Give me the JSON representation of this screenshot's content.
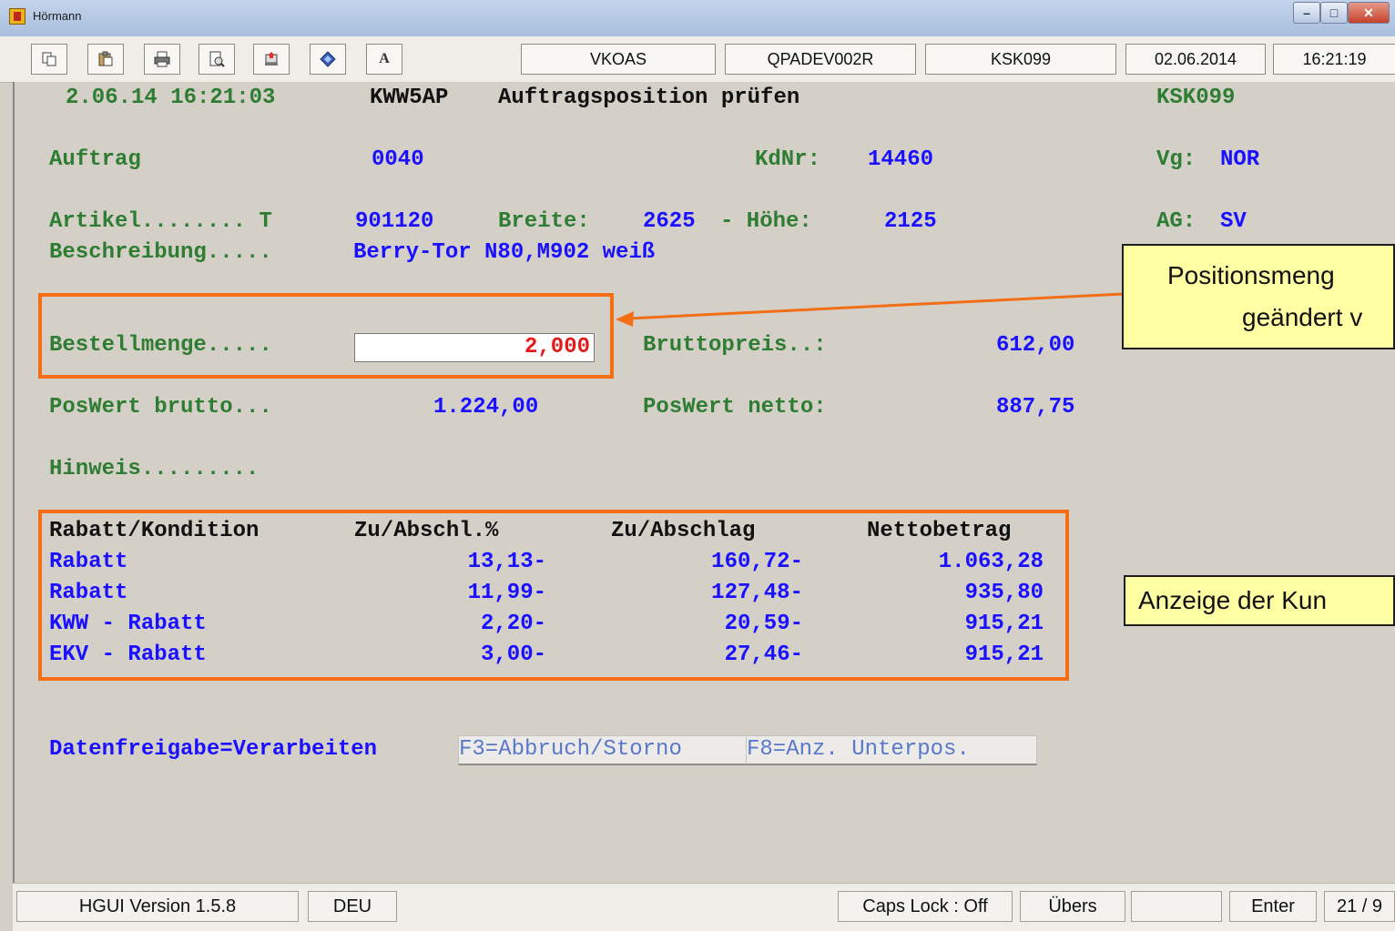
{
  "window": {
    "title": "Hörmann"
  },
  "toolbar": {
    "icons": [
      "copy-icon",
      "paste-icon",
      "print-icon",
      "print-preview-icon",
      "print-screen-icon",
      "help-diamond-icon",
      "font-icon"
    ],
    "font_button_label": "A",
    "session_fields": [
      "VKOAS",
      "QPADEV002R",
      "KSK099",
      "02.06.2014",
      "16:21:19"
    ]
  },
  "screen": {
    "header": {
      "datetime": "2.06.14 16:21:03",
      "program": "KWW5AP",
      "title": "Auftragsposition prüfen",
      "user": "KSK099"
    },
    "auftrag_label": "Auftrag",
    "auftrag_value": "0040",
    "kdnr_label": "KdNr:",
    "kdnr_value": "14460",
    "vg_label": "Vg:",
    "vg_value": "NOR",
    "artikel_label": "Artikel........ T",
    "artikel_value": "901120",
    "breite_label": "Breite:",
    "breite_value": "2625",
    "hoehe_label": "- Höhe:",
    "hoehe_value": "2125",
    "ag_label": "AG:",
    "ag_value": "SV",
    "beschreibung_label": "Beschreibung.....",
    "beschreibung_value": "Berry-Tor N80,M902 weiß",
    "bestellmenge_label": "Bestellmenge.....",
    "bestellmenge_value": "2,000",
    "bruttopreis_label": "Bruttopreis..:",
    "bruttopreis_value": "612,00",
    "poswert_brutto_label": "PosWert brutto...",
    "poswert_brutto_value": "1.224,00",
    "poswert_netto_label": "PosWert netto:",
    "poswert_netto_value": "887,75",
    "hinweis_label": "Hinweis.........",
    "discount_table": {
      "headers": [
        "Rabatt/Kondition",
        "Zu/Abschl.%",
        "Zu/Abschlag",
        "Nettobetrag"
      ],
      "rows": [
        [
          "Rabatt",
          "13,13-",
          "160,72-",
          "1.063,28"
        ],
        [
          "Rabatt",
          "11,99-",
          "127,48-",
          "935,80"
        ],
        [
          "KWW - Rabatt",
          "2,20-",
          "20,59-",
          "915,21"
        ],
        [
          "EKV - Rabatt",
          "3,00-",
          "27,46-",
          "915,21"
        ]
      ]
    },
    "datenfreigabe": "Datenfreigabe=Verarbeiten",
    "fkeys": [
      "F3=Abbruch/Storno",
      "F8=Anz. Unterpos."
    ]
  },
  "callouts": {
    "top_line1": "Positionsmeng",
    "top_line2": "geändert v",
    "bottom": "Anzeige der Kun"
  },
  "statusbar": {
    "version": "HGUI Version 1.5.8",
    "language": "DEU",
    "caps_lock": "Caps Lock : Off",
    "uebers": "Übers",
    "empty": "",
    "enter": "Enter",
    "cursor": "21 / 9"
  },
  "colors": {
    "label_green": "#2e7d32",
    "value_blue": "#1a10ff",
    "highlight_orange": "#f36e15",
    "callout_yellow": "#ffffa3",
    "input_red": "#e31b1b"
  }
}
